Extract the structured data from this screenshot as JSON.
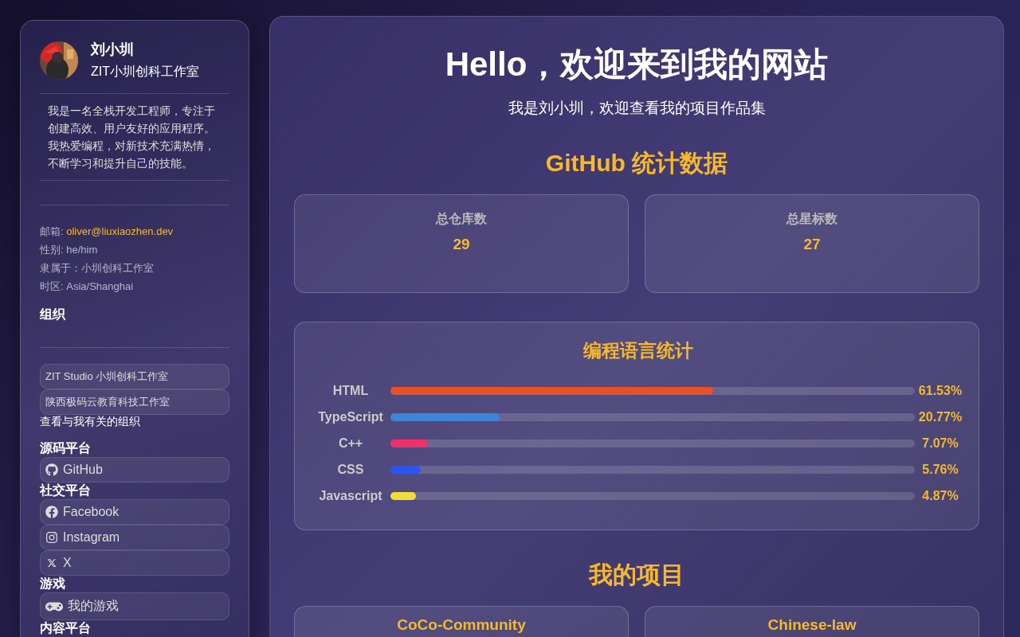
{
  "profile": {
    "name": "刘小圳",
    "org": "ZIT小圳创科工作室",
    "bio": "我是一名全栈开发工程师，专注于创建高效、用户友好的应用程序。我热爱编程，对新技术充满热情，不断学习和提升自己的技能。",
    "details": [
      {
        "label": "邮箱: ",
        "value": "oliver@liuxiaozhen.dev",
        "kind": "link"
      },
      {
        "label": "性别: ",
        "value": "he/him",
        "kind": "text"
      },
      {
        "label": "隶属于：",
        "value": "小圳创科工作室",
        "kind": "text"
      },
      {
        "label": "时区: ",
        "value": "Asia/Shanghai",
        "kind": "text"
      }
    ]
  },
  "organizations": {
    "title": "组织",
    "items": [
      "ZIT Studio 小圳创科工作室",
      "陕西极码云教育科技工作室"
    ],
    "link": "查看与我有关的组织"
  },
  "platform_groups": [
    {
      "title": "源码平台",
      "links": [
        {
          "kind": "github",
          "label": "GitHub"
        }
      ]
    },
    {
      "title": "社交平台",
      "links": [
        {
          "kind": "facebook",
          "label": "Facebook"
        },
        {
          "kind": "instagram",
          "label": "Instagram"
        },
        {
          "kind": "x",
          "label": "X"
        }
      ]
    },
    {
      "title": "游戏",
      "links": [
        {
          "kind": "gamepad",
          "label": "我的游戏"
        }
      ]
    },
    {
      "title": "内容平台"
    }
  ],
  "hero": {
    "title": "Hello，欢迎来到我的网站",
    "subtitle": "我是刘小圳，欢迎查看我的项目作品集"
  },
  "github_stats": {
    "title": "GitHub 统计数据",
    "cards": [
      {
        "label": "总仓库数",
        "value": "29"
      },
      {
        "label": "总星标数",
        "value": "27"
      }
    ]
  },
  "languages": {
    "title": "编程语言统计",
    "items": [
      {
        "name": "HTML",
        "level": 0.6153,
        "reading": "61.53%",
        "color": "#e8502a"
      },
      {
        "name": "TypeScript",
        "level": 0.2077,
        "reading": "20.77%",
        "color": "#3d86d6"
      },
      {
        "name": "C++",
        "level": 0.0707,
        "reading": "7.07%",
        "color": "#f0306a"
      },
      {
        "name": "CSS",
        "level": 0.0576,
        "reading": "5.76%",
        "color": "#2a56f0"
      },
      {
        "name": "Javascript",
        "level": 0.0487,
        "reading": "4.87%",
        "color": "#f0dc3a"
      }
    ]
  },
  "projects": {
    "title": "我的项目",
    "items": [
      {
        "name": "CoCo-Community"
      },
      {
        "name": "Chinese-law"
      }
    ]
  }
}
